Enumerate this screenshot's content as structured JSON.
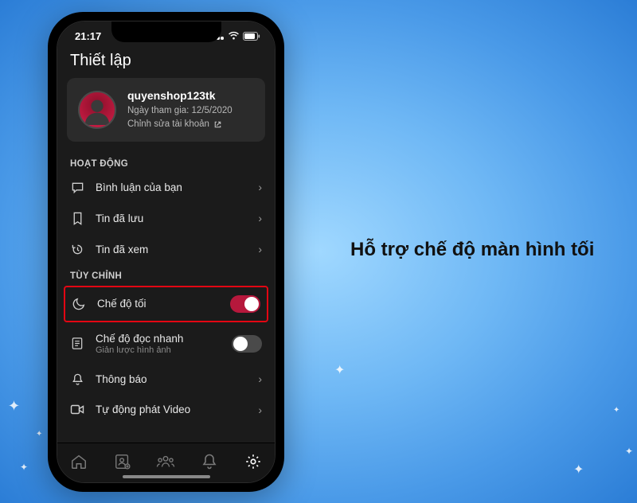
{
  "caption": "Hỗ trợ chế độ màn hình tối",
  "statusbar": {
    "time": "21:17"
  },
  "page": {
    "title": "Thiết lập"
  },
  "profile": {
    "username": "quyenshop123tk",
    "joined_label": "Ngày tham gia: 12/5/2020",
    "edit_label": "Chỉnh sửa tài khoản"
  },
  "sections": {
    "activity_header": "HOẠT ĐỘNG",
    "customize_header": "TÙY CHỈNH"
  },
  "activity": {
    "comments": "Bình luận của bạn",
    "saved": "Tin đã lưu",
    "viewed": "Tin đã xem"
  },
  "customize": {
    "dark_mode": "Chế độ tối",
    "fast_read": "Chế độ đọc nhanh",
    "fast_read_sub": "Giản lược hình ảnh",
    "notifications": "Thông báo",
    "autoplay": "Tự động phát Video"
  }
}
